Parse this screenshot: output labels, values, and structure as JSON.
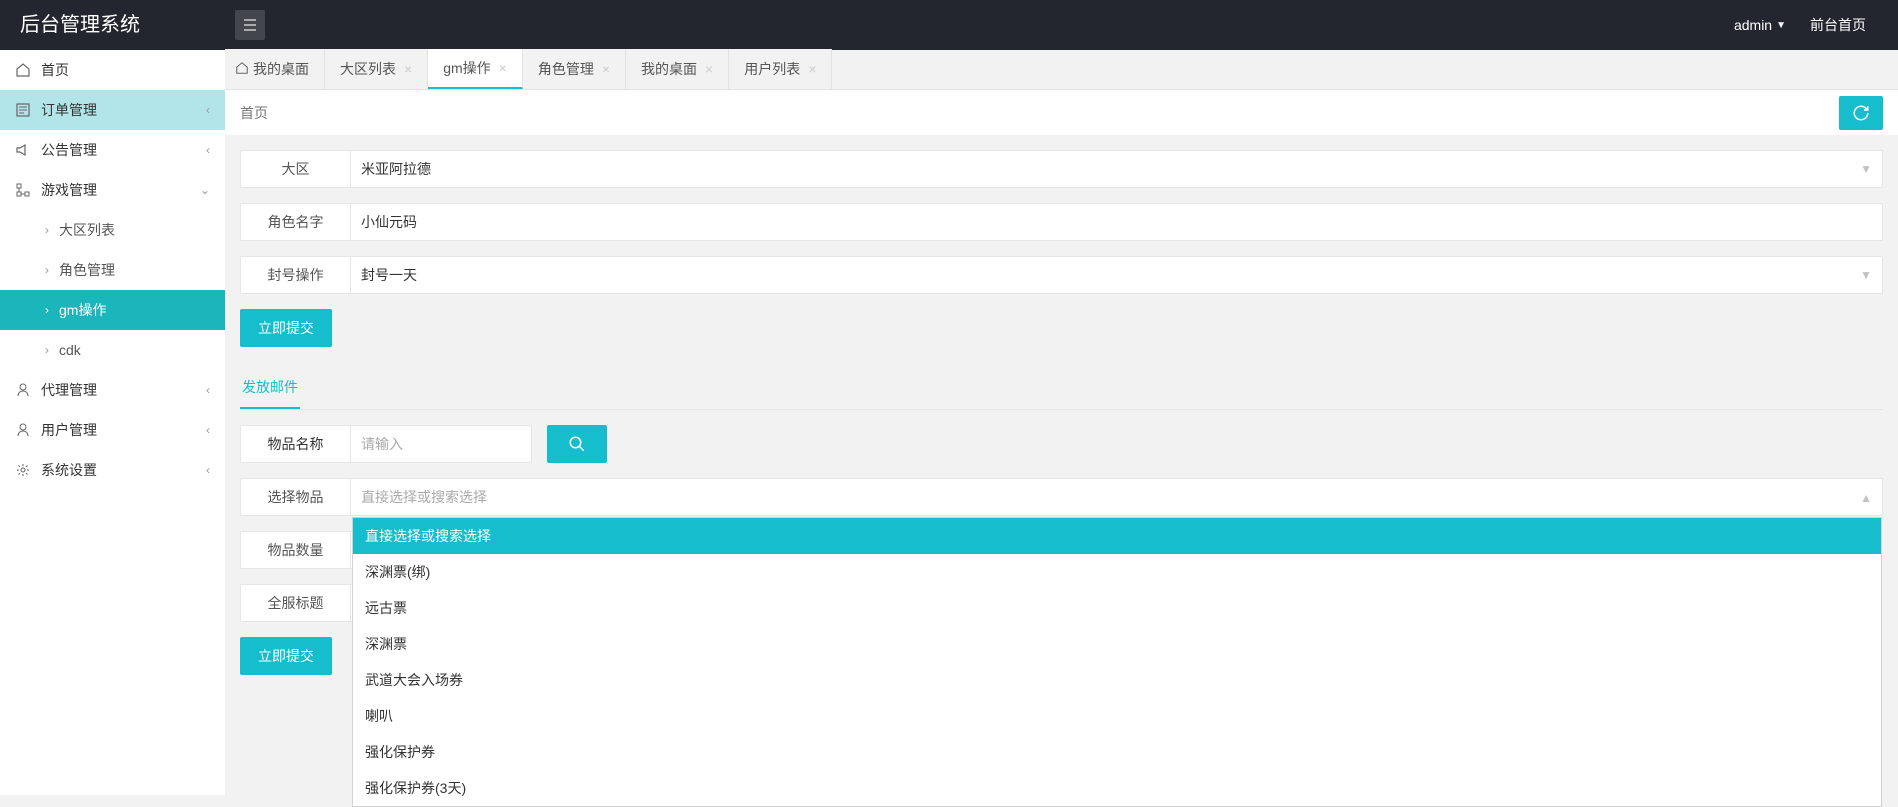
{
  "header": {
    "logo": "后台管理系统",
    "user": "admin",
    "frontpage": "前台首页"
  },
  "sidebar": {
    "items": [
      {
        "label": "首页"
      },
      {
        "label": "订单管理"
      },
      {
        "label": "公告管理"
      },
      {
        "label": "游戏管理"
      },
      {
        "label": "代理管理"
      },
      {
        "label": "用户管理"
      },
      {
        "label": "系统设置"
      }
    ],
    "game_sub": [
      {
        "label": "大区列表"
      },
      {
        "label": "角色管理"
      },
      {
        "label": "gm操作"
      },
      {
        "label": "cdk"
      }
    ]
  },
  "tabs": [
    {
      "label": "我的桌面"
    },
    {
      "label": "大区列表"
    },
    {
      "label": "gm操作"
    },
    {
      "label": "角色管理"
    },
    {
      "label": "我的桌面"
    },
    {
      "label": "用户列表"
    }
  ],
  "breadcrumb": "首页",
  "form": {
    "region_label": "大区",
    "region_value": "米亚阿拉德",
    "char_label": "角色名字",
    "char_value": "小仙元码",
    "ban_label": "封号操作",
    "ban_value": "封号一天",
    "submit": "立即提交"
  },
  "mail": {
    "tab": "发放邮件",
    "item_name_label": "物品名称",
    "item_name_placeholder": "请输入",
    "select_label": "选择物品",
    "select_placeholder": "直接选择或搜索选择",
    "qty_label": "物品数量",
    "title_label": "全服标题",
    "submit": "立即提交",
    "options": [
      "直接选择或搜索选择",
      "深渊票(绑)",
      "远古票",
      "深渊票",
      "武道大会入场券",
      "喇叭",
      "强化保护券",
      "强化保护券(3天)"
    ]
  }
}
